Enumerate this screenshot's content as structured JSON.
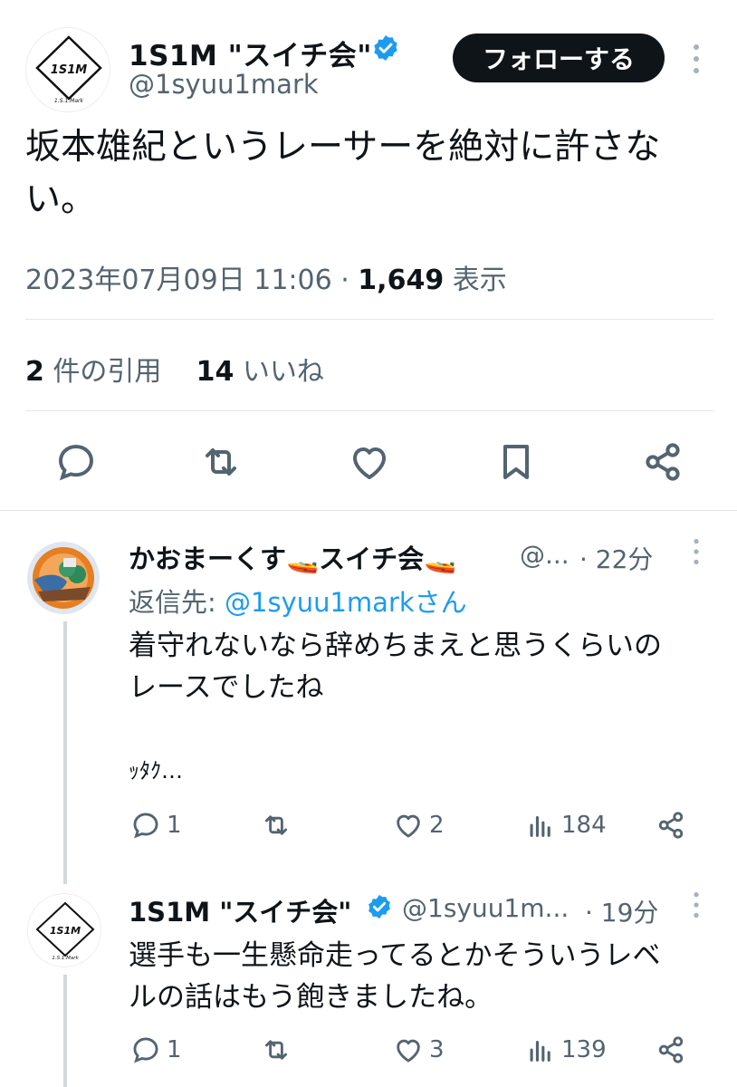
{
  "main_tweet": {
    "avatar_text": "1S1M",
    "avatar_sub": "1.S.1.Mark",
    "display_name": "1S1M \"スイチ会\"",
    "handle": "@1syuu1mark",
    "follow_label": "フォローする",
    "text": "坂本雄紀というレーサーを絶対に許さない。",
    "timestamp": "2023年07月09日 11:06",
    "views_count": "1,649",
    "views_label": "表示",
    "quotes_count": "2",
    "quotes_label": "件の引用",
    "likes_count": "14",
    "likes_label": "いいね"
  },
  "replies": [
    {
      "display_name": "かおまーくす🚤スイチ会🚤",
      "handle": "@...",
      "time": "· 22分",
      "reply_to_prefix": "返信先: ",
      "reply_to_mention": "@1syuu1markさん",
      "text_line1": "着守れないなら辞めちまえと思うくらいの",
      "text_line2": "レースでしたね",
      "text_line3": "ｯﾀｸ…",
      "reply_count": "1",
      "retweet_count": "",
      "like_count": "2",
      "view_count": "184"
    },
    {
      "avatar_text": "1S1M",
      "avatar_sub": "1.S.1.Mark",
      "display_name": "1S1M \"スイチ会\"",
      "handle": "@1syuu1m...",
      "time": "· 19分",
      "text_line1": "選手も一生懸命走ってるとかそういうレベ",
      "text_line2": "ルの話はもう飽きましたね。",
      "reply_count": "1",
      "retweet_count": "",
      "like_count": "3",
      "view_count": "139"
    }
  ],
  "colors": {
    "text": "#0f1419",
    "secondary": "#536471",
    "accent": "#1d9bf0",
    "verified": "#1d9bf0",
    "divider": "#e3e6e8"
  },
  "icons": [
    "verified-badge-icon",
    "more-icon",
    "reply-icon",
    "retweet-icon",
    "like-icon",
    "bookmark-icon",
    "share-icon",
    "views-icon"
  ]
}
